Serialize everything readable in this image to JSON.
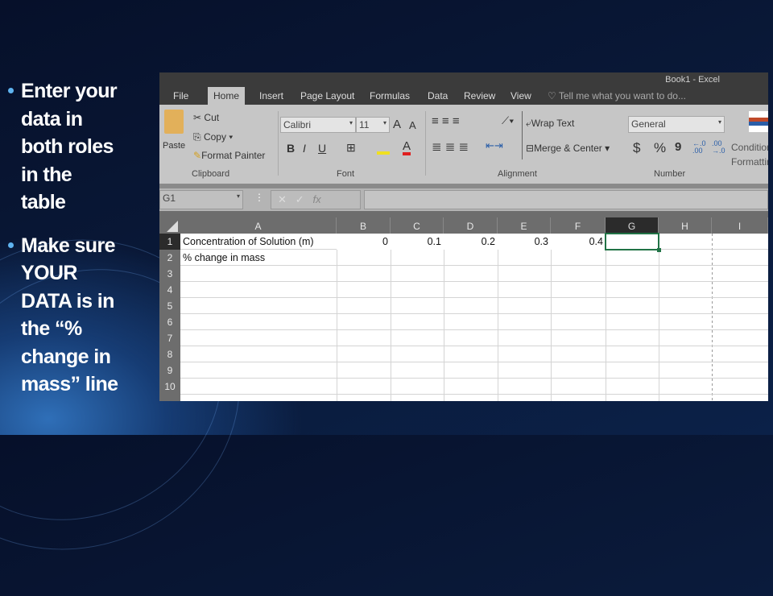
{
  "slide": {
    "bullets": [
      {
        "lines": [
          "Enter your",
          "data in",
          "both roles",
          "in the",
          "table"
        ]
      },
      {
        "lines": [
          "Make sure",
          "YOUR",
          "DATA is in",
          "the “%",
          "change in",
          "mass” line"
        ]
      }
    ]
  },
  "excel": {
    "window_title": "Book1 - Excel",
    "tabs": [
      "File",
      "Home",
      "Insert",
      "Page Layout",
      "Formulas",
      "Data",
      "Review",
      "View"
    ],
    "tell_me": "Tell me what you want to do...",
    "clipboard": {
      "paste": "Paste",
      "cut": "Cut",
      "copy": "Copy",
      "format_painter": "Format Painter",
      "group": "Clipboard"
    },
    "font": {
      "name": "Calibri",
      "size": "11",
      "bold": "B",
      "italic": "I",
      "underline": "U",
      "group": "Font"
    },
    "alignment": {
      "wrap": "Wrap Text",
      "merge": "Merge & Center",
      "group": "Alignment"
    },
    "number": {
      "format": "General",
      "currency": "$",
      "percent": "%",
      "comma": "9",
      "group": "Number"
    },
    "styles": {
      "conditional": "Conditional Formatting"
    },
    "name_box": "G1",
    "fx": "fx",
    "columns": [
      "A",
      "B",
      "C",
      "D",
      "E",
      "F",
      "G",
      "H",
      "I"
    ],
    "rows": [
      "1",
      "2",
      "3",
      "4",
      "5",
      "6",
      "7",
      "8",
      "9",
      "10"
    ],
    "cells": {
      "A1": "Concentration of Solution (m)",
      "B1": "0",
      "C1": "0.1",
      "D1": "0.2",
      "E1": "0.3",
      "F1": "0.4",
      "A2": "% change in mass"
    },
    "selected_cell": "G1",
    "accent": "#217346"
  }
}
